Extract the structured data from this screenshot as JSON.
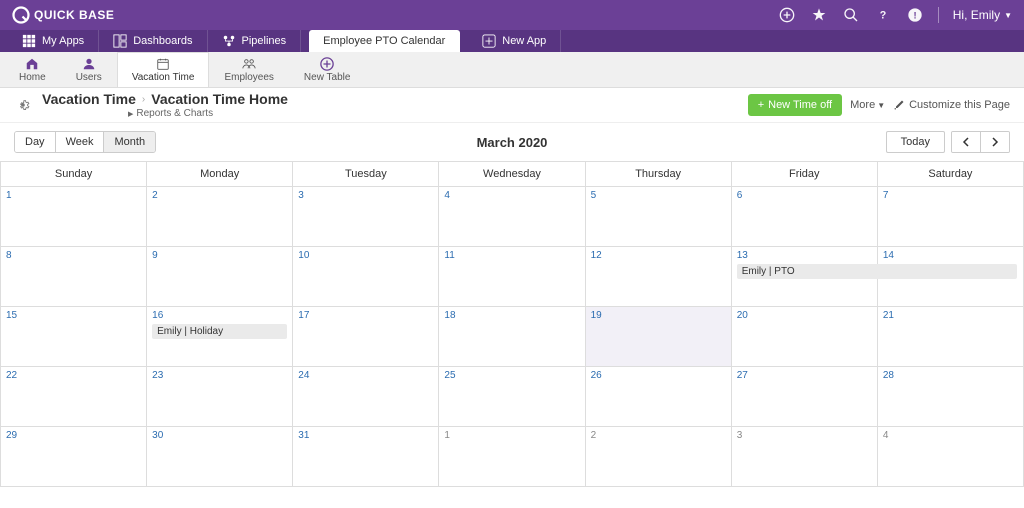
{
  "header": {
    "brand": "QUICK BASE",
    "user_greeting": "Hi, Emily"
  },
  "tabs": {
    "myapps": "My Apps",
    "dashboards": "Dashboards",
    "pipelines": "Pipelines",
    "active": "Employee PTO Calendar",
    "newapp": "New App"
  },
  "subtabs": {
    "home": "Home",
    "users": "Users",
    "vacation": "Vacation Time",
    "employees": "Employees",
    "newtable": "New Table"
  },
  "page": {
    "bc_root": "Vacation Time",
    "bc_current": "Vacation Time Home",
    "sublink": "Reports & Charts",
    "new_btn": "New Time off",
    "more": "More",
    "customize": "Customize this Page"
  },
  "calendar": {
    "view_day": "Day",
    "view_week": "Week",
    "view_month": "Month",
    "title": "March 2020",
    "today": "Today",
    "days": [
      "Sunday",
      "Monday",
      "Tuesday",
      "Wednesday",
      "Thursday",
      "Friday",
      "Saturday"
    ],
    "weeks": [
      [
        {
          "n": "1"
        },
        {
          "n": "2"
        },
        {
          "n": "3"
        },
        {
          "n": "4"
        },
        {
          "n": "5"
        },
        {
          "n": "6"
        },
        {
          "n": "7"
        }
      ],
      [
        {
          "n": "8"
        },
        {
          "n": "9"
        },
        {
          "n": "10"
        },
        {
          "n": "11"
        },
        {
          "n": "12"
        },
        {
          "n": "13",
          "event": "Emily | PTO",
          "span": 2
        },
        {
          "n": "14"
        }
      ],
      [
        {
          "n": "15"
        },
        {
          "n": "16",
          "event": "Emily | Holiday",
          "span": 1
        },
        {
          "n": "17"
        },
        {
          "n": "18"
        },
        {
          "n": "19",
          "today": true
        },
        {
          "n": "20"
        },
        {
          "n": "21"
        }
      ],
      [
        {
          "n": "22"
        },
        {
          "n": "23"
        },
        {
          "n": "24"
        },
        {
          "n": "25"
        },
        {
          "n": "26"
        },
        {
          "n": "27"
        },
        {
          "n": "28"
        }
      ],
      [
        {
          "n": "29"
        },
        {
          "n": "30"
        },
        {
          "n": "31"
        },
        {
          "n": "1",
          "other": true
        },
        {
          "n": "2",
          "other": true
        },
        {
          "n": "3",
          "other": true
        },
        {
          "n": "4",
          "other": true
        }
      ]
    ]
  }
}
